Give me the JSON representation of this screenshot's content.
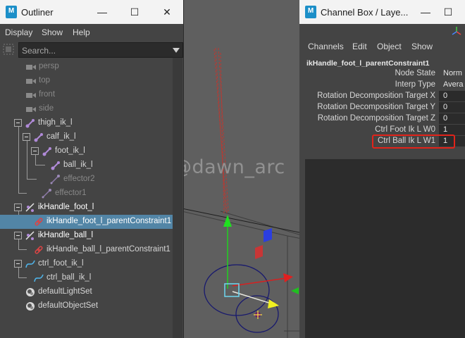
{
  "watermark": "@dawn_arc",
  "outliner": {
    "title": "Outliner",
    "logo": "M",
    "controls": {
      "minimize": "—",
      "maximize": "☐",
      "close": "✕"
    },
    "menu": [
      "Display",
      "Show",
      "Help"
    ],
    "search_placeholder": "Search...",
    "items": [
      {
        "label": "persp",
        "icon": "camera-icon",
        "style": "dim"
      },
      {
        "label": "top",
        "icon": "camera-icon",
        "style": "dim"
      },
      {
        "label": "front",
        "icon": "camera-icon",
        "style": "dim"
      },
      {
        "label": "side",
        "icon": "camera-icon",
        "style": "dim"
      },
      {
        "label": "thigh_ik_l",
        "icon": "joint-icon",
        "style": "normal"
      },
      {
        "label": "calf_ik_l",
        "icon": "joint-icon",
        "style": "normal"
      },
      {
        "label": "foot_ik_l",
        "icon": "joint-icon",
        "style": "normal"
      },
      {
        "label": "ball_ik_l",
        "icon": "joint-icon",
        "style": "normal"
      },
      {
        "label": "effector2",
        "icon": "effector-icon",
        "style": "dim"
      },
      {
        "label": "effector1",
        "icon": "effector-icon",
        "style": "dim"
      },
      {
        "label": "ikHandle_foot_l",
        "icon": "ik-handle-icon",
        "style": "white"
      },
      {
        "label": "ikHandle_foot_l_parentConstraint1",
        "icon": "constraint-icon",
        "style": "selected"
      },
      {
        "label": "ikHandle_ball_l",
        "icon": "ik-handle-icon",
        "style": "white"
      },
      {
        "label": "ikHandle_ball_l_parentConstraint1",
        "icon": "constraint-icon",
        "style": "normal"
      },
      {
        "label": "ctrl_foot_ik_l",
        "icon": "curve-icon",
        "style": "normal"
      },
      {
        "label": "ctrl_ball_ik_l",
        "icon": "curve-icon",
        "style": "normal"
      },
      {
        "label": "defaultLightSet",
        "icon": "set-icon",
        "style": "normal"
      },
      {
        "label": "defaultObjectSet",
        "icon": "set-icon",
        "style": "normal"
      }
    ]
  },
  "channel_box": {
    "title": "Channel Box / Laye...",
    "logo": "M",
    "controls": {
      "minimize": "—",
      "maximize": "☐"
    },
    "menu": [
      "Channels",
      "Edit",
      "Object",
      "Show"
    ],
    "node": "ikHandle_foot_l_parentConstraint1",
    "attributes": [
      {
        "label": "Node State",
        "value": "Norm"
      },
      {
        "label": "Interp Type",
        "value": "Avera"
      },
      {
        "label": "Rotation Decomposition Target X",
        "value": "0"
      },
      {
        "label": "Rotation Decomposition Target Y",
        "value": "0"
      },
      {
        "label": "Rotation Decomposition Target Z",
        "value": "0"
      },
      {
        "label": "Ctrl Foot Ik L W0",
        "value": "1"
      },
      {
        "label": "Ctrl Ball Ik L W1",
        "value": "1"
      }
    ],
    "highlighted_attribute": "Ctrl Ball Ik L W1",
    "highlight_color": "#e2231a"
  },
  "colors": {
    "selection": "#5285a6",
    "viewport_bg": "#5f5f5f",
    "panel_bg": "#444444",
    "maya_blue": "#1c8fc8"
  }
}
